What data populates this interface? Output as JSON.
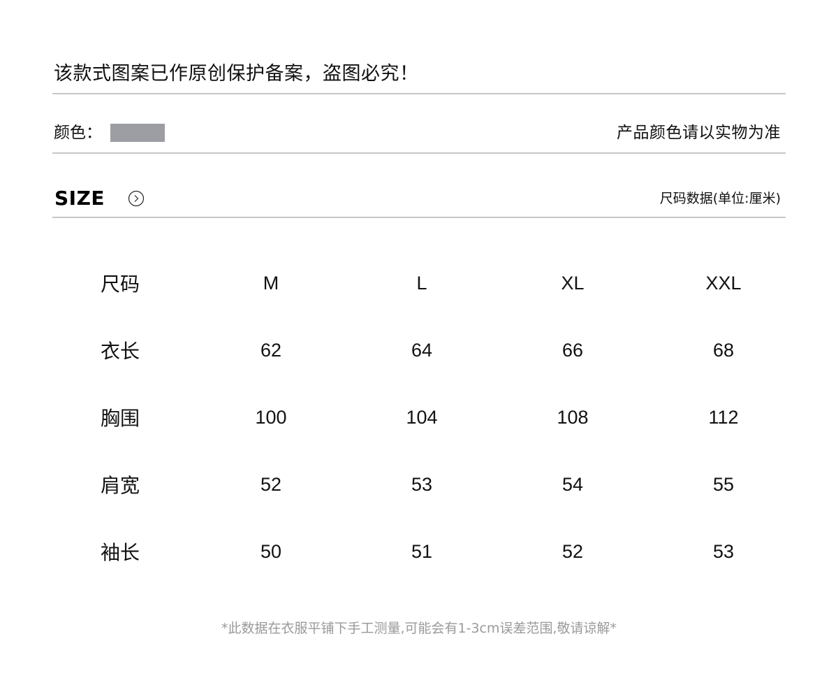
{
  "notice": "该款式图案已作原创保护备案，盗图必究！",
  "color": {
    "label": "颜色：",
    "swatch_color": "#9d9ea3",
    "note": "产品颜色请以实物为准"
  },
  "size_section": {
    "title": "SIZE",
    "arrow_icon": "chevron-right-circle-icon",
    "unit_note": "尺码数据(单位:厘米)"
  },
  "size_table": {
    "header": {
      "label": "尺码",
      "sizes": [
        "M",
        "L",
        "XL",
        "XXL"
      ]
    },
    "rows": [
      {
        "label": "衣长",
        "values": [
          "62",
          "64",
          "66",
          "68"
        ]
      },
      {
        "label": "胸围",
        "values": [
          "100",
          "104",
          "108",
          "112"
        ]
      },
      {
        "label": "肩宽",
        "values": [
          "52",
          "53",
          "54",
          "55"
        ]
      },
      {
        "label": "袖长",
        "values": [
          "50",
          "51",
          "52",
          "53"
        ]
      }
    ]
  },
  "footnote": "*此数据在衣服平铺下手工测量,可能会有1-3cm误差范围,敬请谅解*"
}
